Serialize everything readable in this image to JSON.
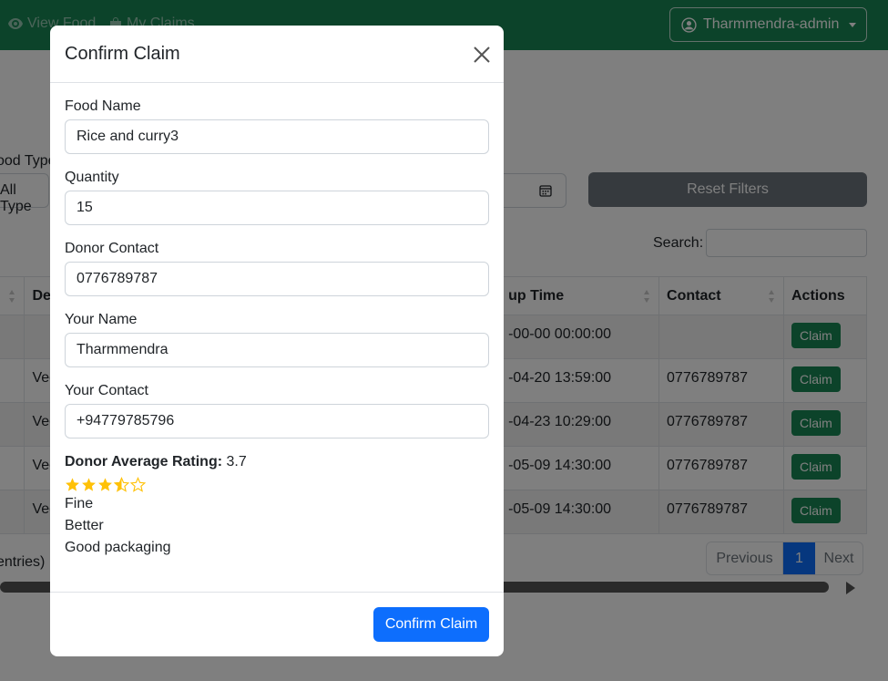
{
  "navbar": {
    "links": [
      "View Food",
      "My Claims"
    ],
    "user": "Tharmmendra-admin",
    "color": "#198754"
  },
  "filters": {
    "food_type_label": "ood Type",
    "food_type_value": "All Type",
    "reset_label": "Reset Filters"
  },
  "search": {
    "label": "Search:"
  },
  "table": {
    "headers": [
      "De",
      "up Time",
      "Contact",
      "Actions"
    ],
    "rows": [
      [
        "",
        "-00-00 00:00:00",
        "",
        "Claim"
      ],
      [
        "Veg",
        "-04-20 13:59:00",
        "0776789787",
        "Claim"
      ],
      [
        "Veg",
        "-04-23 10:29:00",
        "0776789787",
        "Claim"
      ],
      [
        "Veg",
        "-05-09 14:30:00",
        "0776789787",
        "Claim"
      ],
      [
        "Veg",
        "-05-09 14:30:00",
        "0776789787",
        "Claim"
      ]
    ]
  },
  "footer": {
    "entries_info": "entries)",
    "pagination": {
      "previous": "Previous",
      "current": "1",
      "next": "Next"
    }
  },
  "modal": {
    "title": "Confirm Claim",
    "fields": [
      {
        "label": "Food Name",
        "value": "Rice and curry3"
      },
      {
        "label": "Quantity",
        "value": "15"
      },
      {
        "label": "Donor Contact",
        "value": "0776789787"
      },
      {
        "label": "Your Name",
        "value": "Tharmmendra"
      },
      {
        "label": "Your Contact",
        "value": "+94779785796"
      }
    ],
    "rating_label": "Donor Average Rating:",
    "rating_value": "3.7",
    "stars_out_of_5": 3.7,
    "star_color": "#ffc107",
    "comments": [
      "Fine",
      "Better",
      "Good packaging"
    ],
    "confirm_label": "Confirm Claim",
    "confirm_color": "#0d6efd"
  }
}
